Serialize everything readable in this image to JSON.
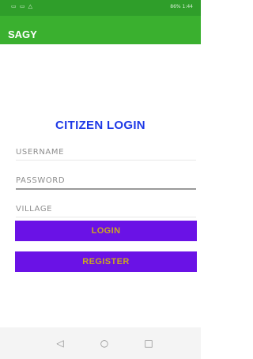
{
  "status_bar": {
    "left_icons": "▭ ▭ △",
    "right_text": "86% 1:44"
  },
  "app_bar": {
    "title": "SAGY"
  },
  "login": {
    "title": "CITIZEN LOGIN",
    "username_placeholder": "USERNAME",
    "password_placeholder": "PASSWORD",
    "village_placeholder": "VILLAGE",
    "login_label": "LOGIN",
    "register_label": "REGISTER"
  },
  "nav_bar": {
    "back_icon": "◁",
    "home_icon": "○",
    "recents_icon": "□"
  },
  "colors": {
    "status_bar": "#2f9e2a",
    "app_bar": "#3ab02f",
    "title": "#1e39e6",
    "button_bg": "#6a12e6",
    "button_text": "#caa623"
  }
}
